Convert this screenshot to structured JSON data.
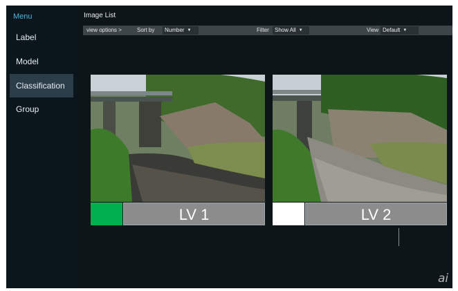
{
  "sidebar": {
    "menu_title": "Menu",
    "items": [
      {
        "label": "Label"
      },
      {
        "label": "Model"
      },
      {
        "label": "Classification"
      },
      {
        "label": "Group"
      }
    ]
  },
  "main": {
    "title": "Image List",
    "toolbar": {
      "view_options": "view options >",
      "sort_by_label": "Sort by",
      "sort_by_value": "Number",
      "filter_label": "Filter",
      "filter_value": "Show All",
      "view_label": "View",
      "view_value": "Default"
    },
    "cards": [
      {
        "label": "LV 1",
        "swatch_color": "#00b050"
      },
      {
        "label": "LV 2",
        "swatch_color": "#ffffff"
      }
    ]
  },
  "colors": {
    "active_item": "#2c3d4a",
    "menu_title": "#48b4e4"
  },
  "watermark": "ai"
}
